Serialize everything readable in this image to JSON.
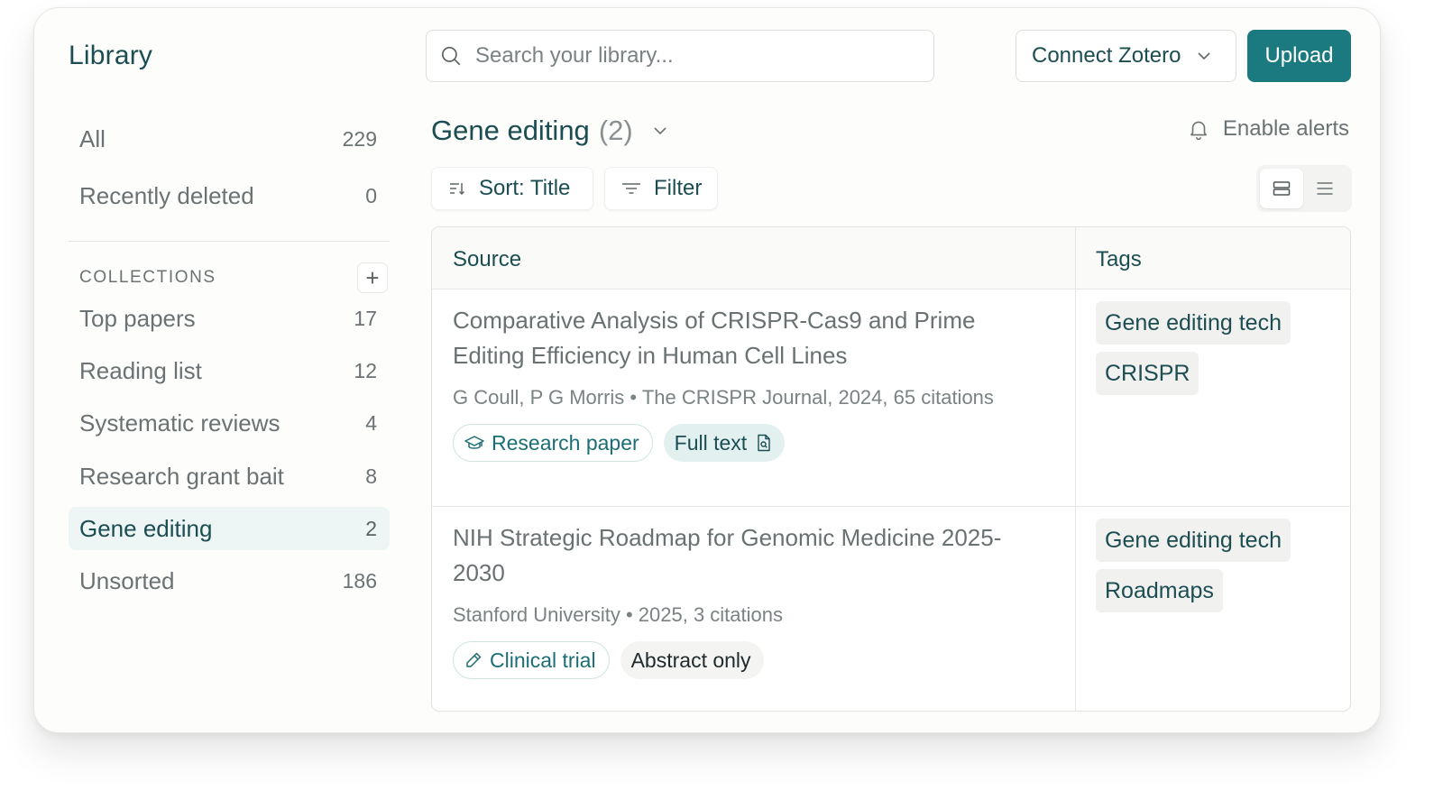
{
  "sidebar": {
    "title": "Library",
    "top_items": [
      {
        "label": "All",
        "count": "229"
      },
      {
        "label": "Recently deleted",
        "count": "0"
      }
    ],
    "collections_heading": "COLLECTIONS",
    "add_symbol": "+",
    "collections": [
      {
        "label": "Top papers",
        "count": "17"
      },
      {
        "label": "Reading list",
        "count": "12"
      },
      {
        "label": "Systematic reviews",
        "count": "4"
      },
      {
        "label": "Research grant bait",
        "count": "8"
      },
      {
        "label": "Gene editing",
        "count": "2",
        "active": true
      },
      {
        "label": "Unsorted",
        "count": "186"
      }
    ]
  },
  "topbar": {
    "search_placeholder": "Search your library...",
    "connect_label": "Connect Zotero",
    "upload_label": "Upload"
  },
  "header": {
    "collection_name": "Gene editing",
    "collection_count": "(2)",
    "alerts_label": "Enable alerts"
  },
  "toolbar": {
    "sort_label": "Sort: Title",
    "filter_label": "Filter"
  },
  "table": {
    "columns": [
      "Source",
      "Tags"
    ],
    "rows": [
      {
        "title": "Comparative Analysis of CRISPR-Cas9 and Prime Editing Efficiency in Human Cell Lines",
        "meta": "G Coull, P G Morris • The CRISPR Journal, 2024, 65 citations",
        "type_label": "Research paper",
        "type_icon": "graduation-cap-icon",
        "access_label": "Full text",
        "access_icon": "document-icon",
        "tags": [
          "Gene editing tech",
          "CRISPR"
        ]
      },
      {
        "title": "NIH Strategic Roadmap for Genomic Medicine 2025-2030",
        "meta": "Stanford University • 2025, 3 citations",
        "type_label": "Clinical trial",
        "type_icon": "pencil-icon",
        "access_label": "Abstract only",
        "tags": [
          "Gene editing tech",
          "Roadmaps"
        ]
      }
    ]
  },
  "colors": {
    "accent": "#1b7a7f",
    "heading": "#1b4d52",
    "active_bg": "#eef6f5"
  }
}
